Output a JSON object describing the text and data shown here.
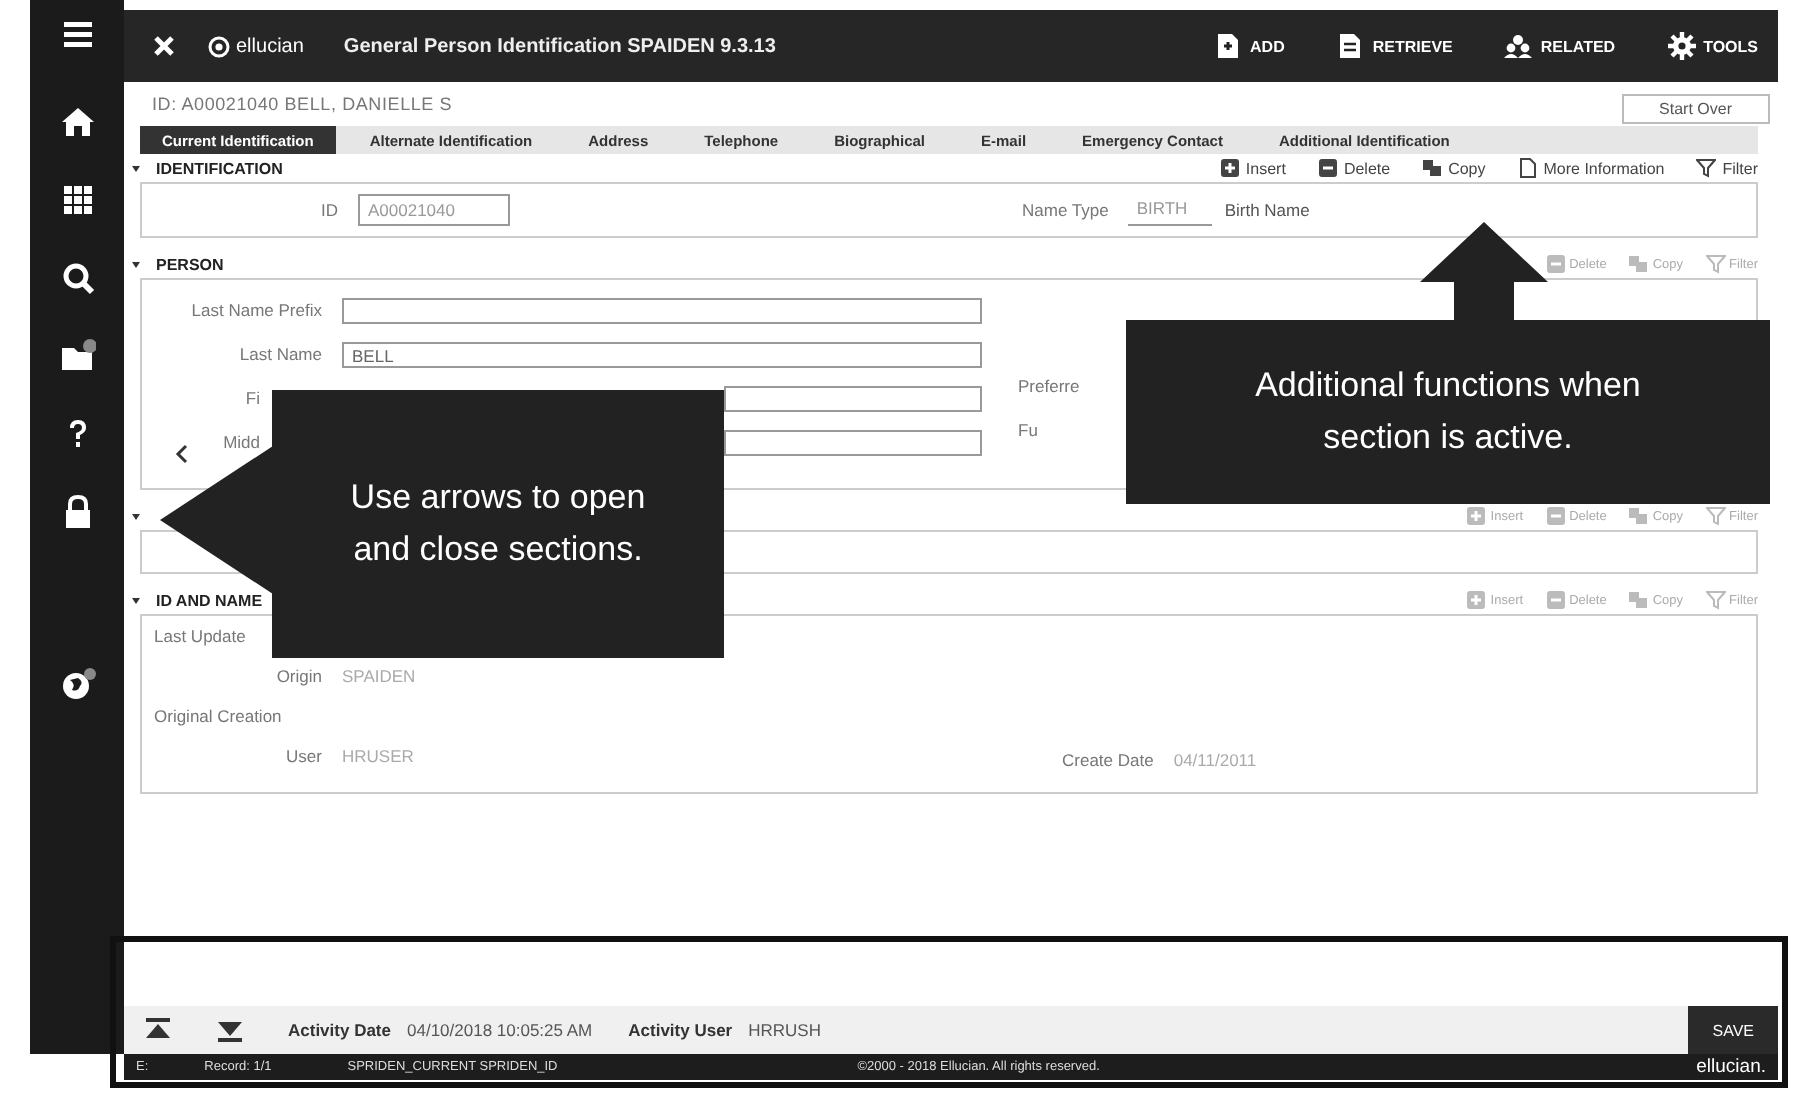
{
  "sidebar": {
    "items": [
      {
        "kind": "menu"
      },
      {
        "kind": "home"
      },
      {
        "kind": "apps"
      },
      {
        "kind": "search"
      },
      {
        "kind": "folder"
      },
      {
        "kind": "help"
      },
      {
        "kind": "lock"
      },
      {
        "kind": "globe"
      }
    ]
  },
  "top_bar": {
    "logo": "ellucian",
    "title": "General Person Identification SPAIDEN 9.3.13",
    "actions": [
      {
        "label": "ADD",
        "kind": "add"
      },
      {
        "label": "RETRIEVE",
        "kind": "retrieve"
      },
      {
        "label": "RELATED",
        "kind": "related"
      },
      {
        "label": "TOOLS",
        "kind": "tools"
      }
    ]
  },
  "key_block": {
    "text": "ID: A00021040  BELL, DANIELLE S",
    "button": "Start Over"
  },
  "tabs": [
    {
      "label": "Current Identification",
      "selected": true
    },
    {
      "label": "Alternate Identification",
      "selected": false
    },
    {
      "label": "Address",
      "selected": false
    },
    {
      "label": "Telephone",
      "selected": false
    },
    {
      "label": "Biographical",
      "selected": false
    },
    {
      "label": "E-mail",
      "selected": false
    },
    {
      "label": "Emergency Contact",
      "selected": false
    },
    {
      "label": "Additional Identification",
      "selected": false
    }
  ],
  "sections": [
    {
      "title": "IDENTIFICATION",
      "active": true,
      "tools": [
        {
          "label": "Insert",
          "kind": "insert"
        },
        {
          "label": "Delete",
          "kind": "delete"
        },
        {
          "label": "Copy",
          "kind": "copy"
        },
        {
          "label": "More Information",
          "kind": "info"
        },
        {
          "label": "Filter",
          "kind": "filter"
        }
      ],
      "fields_left": [
        {
          "label": "ID",
          "value": "A00021040",
          "kind": "input"
        }
      ],
      "fields_right": [
        {
          "label": "Name Type",
          "value": "BIRTH",
          "kind": "select"
        },
        {
          "value": "Birth Name",
          "kind": "text"
        }
      ]
    },
    {
      "title": "PERSON",
      "active": false,
      "tools": [
        {
          "label": "Delete",
          "kind": "delete"
        },
        {
          "label": "Copy",
          "kind": "copy"
        },
        {
          "label": "Filter",
          "kind": "filter"
        }
      ],
      "fields_left": [
        {
          "label": "Last Name Prefix",
          "kind": "input"
        },
        {
          "label": "Last Name",
          "value": "BELL",
          "kind": "select"
        },
        {
          "label": "Fi",
          "kind": "select"
        },
        {
          "label": "Midd",
          "kind": "input"
        }
      ],
      "fields_right": [
        {
          "label": "Preferre",
          "kind": "text"
        },
        {
          "label": "Fu",
          "kind": "text"
        }
      ]
    },
    {
      "active": false,
      "tools": [
        {
          "label": "Insert",
          "kind": "insert"
        },
        {
          "label": "Delete",
          "kind": "delete"
        },
        {
          "label": "Copy",
          "kind": "copy"
        },
        {
          "label": "Filter",
          "kind": "filter"
        }
      ]
    },
    {
      "title": "ID AND NAME",
      "active": false,
      "tools": [
        {
          "label": "Insert",
          "kind": "insert"
        },
        {
          "label": "Delete",
          "kind": "delete"
        },
        {
          "label": "Copy",
          "kind": "copy"
        },
        {
          "label": "Filter",
          "kind": "filter"
        }
      ],
      "fields_left": [
        {
          "label": "Last Update",
          "kind": "heading"
        },
        {
          "label": "Origin",
          "value": "SPAIDEN",
          "kind": "text"
        },
        {
          "label": "Original Creation",
          "kind": "heading"
        },
        {
          "label": "User",
          "value": "HRUSER",
          "kind": "text"
        }
      ],
      "fields_right": [
        {
          "label": "Create Date",
          "value": "04/11/2011",
          "kind": "text"
        }
      ]
    }
  ],
  "activity": {
    "date_label": "Activity Date",
    "date": "04/10/2018 10:05:25 AM",
    "user_label": "Activity User",
    "user": "HRRUSH",
    "save": "SAVE"
  },
  "status_bar": {
    "error": "E:",
    "record": "Record: 1/1",
    "field": "SPRIDEN_CURRENT SPRIDEN_ID",
    "copyright": "©2000 - 2018 Ellucian. All rights reserved.",
    "brand": "ellucian."
  },
  "callouts": [
    {
      "text": "Use arrows to open and close sections.",
      "kind": "left"
    },
    {
      "text": "Additional functions when section is active.",
      "kind": "up"
    }
  ]
}
